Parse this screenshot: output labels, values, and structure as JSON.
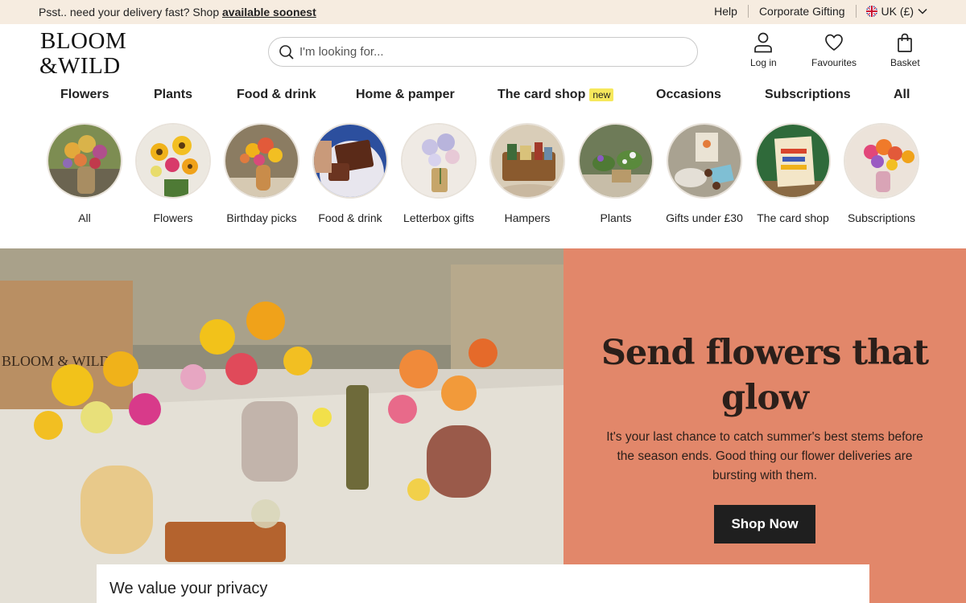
{
  "announcement": {
    "prefix": "Psst.. need your delivery fast? Shop ",
    "link": "available soonest"
  },
  "utility_links": {
    "help": "Help",
    "corporate": "Corporate Gifting",
    "locale": "UK (£)"
  },
  "logo": {
    "line1": "BLOOM",
    "line2": "&WILD"
  },
  "search": {
    "placeholder": "I'm looking for..."
  },
  "header_icons": {
    "login": "Log in",
    "favourites": "Favourites",
    "basket": "Basket"
  },
  "nav": {
    "items": [
      "Flowers",
      "Plants",
      "Food & drink",
      "Home & pamper",
      "The card shop",
      "Occasions",
      "Subscriptions",
      "All"
    ],
    "badge": "new"
  },
  "categories": [
    {
      "label": "All",
      "icon": "bouquet-photo"
    },
    {
      "label": "Flowers",
      "icon": "sunflower-bouquet-photo"
    },
    {
      "label": "Birthday picks",
      "icon": "birthday-bouquet-photo"
    },
    {
      "label": "Food & drink",
      "icon": "brownie-photo"
    },
    {
      "label": "Letterbox gifts",
      "icon": "letterbox-flowers-photo"
    },
    {
      "label": "Hampers",
      "icon": "hamper-photo"
    },
    {
      "label": "Plants",
      "icon": "plant-photo"
    },
    {
      "label": "Gifts under £30",
      "icon": "gift-box-photo"
    },
    {
      "label": "The card shop",
      "icon": "greeting-card-photo"
    },
    {
      "label": "Subscriptions",
      "icon": "subscription-bouquet-photo"
    }
  ],
  "hero": {
    "title": "Send flowers that glow",
    "body": "It's your last chance to catch summer's best stems before the season ends. Good thing our flower deliveries are bursting with them.",
    "cta": "Shop Now",
    "box_brand": "BLOOM & WILD",
    "panel_color": "#e2876a"
  },
  "privacy": {
    "title": "We value your privacy"
  },
  "colors": {
    "topbar": "#f6ece0",
    "button": "#1f1f1f",
    "badge": "#f6e85c"
  }
}
